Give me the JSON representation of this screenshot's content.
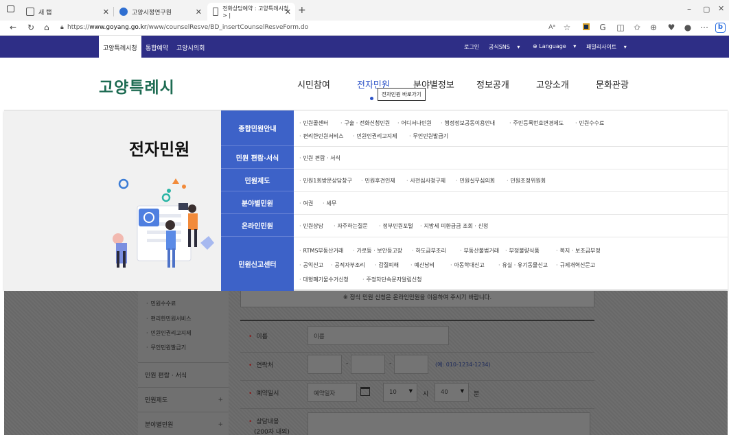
{
  "browser": {
    "tabs": [
      {
        "label": "새 탭"
      },
      {
        "label": "고양시정연구원"
      },
      {
        "label": "전화상담예약 : 고양특례시청 > |"
      }
    ],
    "url_prefix": "https://",
    "url_host": "www.goyang.go.kr",
    "url_path": "/www/counselResve/BD_insertCounselResveForm.do"
  },
  "topbar": {
    "tabs": [
      "고양특례시청",
      "통합예약",
      "고양시의회"
    ],
    "utils": [
      "로그인",
      "공식SNS",
      "Language",
      "패밀리사이트"
    ]
  },
  "header": {
    "logo": "고양특례시",
    "gnb": [
      "시민참여",
      "전자민원",
      "분야별정보",
      "정보공개",
      "고양소개",
      "문화관광"
    ],
    "tooltip": "전자민원 바로가기"
  },
  "mega": {
    "title": "전자민원",
    "categories": [
      {
        "label": "종합민원안내",
        "links": [
          "민원콜센터",
          "구술 · 전화신청민원",
          "어디서나민원",
          "행정정보공동이용안내",
          "주민등록번호변경제도",
          "민원수수료",
          "편리한민원서비스",
          "민원인권리고지제",
          "무인민원발급기"
        ]
      },
      {
        "label": "민원 편람·서식",
        "links": [
          "민원 편람 · 서식"
        ]
      },
      {
        "label": "민원제도",
        "links": [
          "민원1회방문상담창구",
          "민원후견인제",
          "사전심사청구제",
          "민원실무심의회",
          "민원조정위원회"
        ]
      },
      {
        "label": "분야별민원",
        "links": [
          "여권",
          "세무"
        ]
      },
      {
        "label": "온라인민원",
        "links": [
          "민원상담",
          "자주하는질문",
          "정부민원포털",
          "지방세 미환급금 조회 · 신청"
        ]
      },
      {
        "label": "민원신고센터",
        "links": [
          "RTMS부동산거래",
          "가로등 · 보안등고장",
          "하도급부조리",
          "부동산불법거래",
          "부정불량식품",
          "복지 · 보조금부정",
          "공익신고",
          "공직자부조리",
          "갑질피해",
          "예산낭비",
          "아동학대신고",
          "유실 · 유기동물신고",
          "규제개혁신문고",
          "대형폐기물수거신청",
          "주정차단속문자알림신청"
        ]
      }
    ]
  },
  "sidebar": {
    "sub_links": [
      "민원수수료",
      "편리한민원서비스",
      "민원인권리고지제",
      "무인민원발급기"
    ],
    "items": [
      "민원 편람 · 서식",
      "민원제도",
      "분야별민원"
    ]
  },
  "form": {
    "notice": "※ 정식 민원 신청은 온라인민원을 이용하여 주시기 바랍니다.",
    "name_label": "이름",
    "name_placeholder": "이름",
    "phone_label": "연락처",
    "phone_example": "(예: 010-1234-1234)",
    "date_label": "예약일시",
    "date_placeholder": "예약일자",
    "hour_value": "10",
    "hour_unit": "시",
    "minute_value": "40",
    "minute_unit": "분",
    "content_label": "상담내용",
    "content_sub": "(200자 내외)"
  },
  "colors": {
    "topbar": "#2e2e86",
    "accent": "#3d62c8",
    "logo": "#1d6b52"
  }
}
